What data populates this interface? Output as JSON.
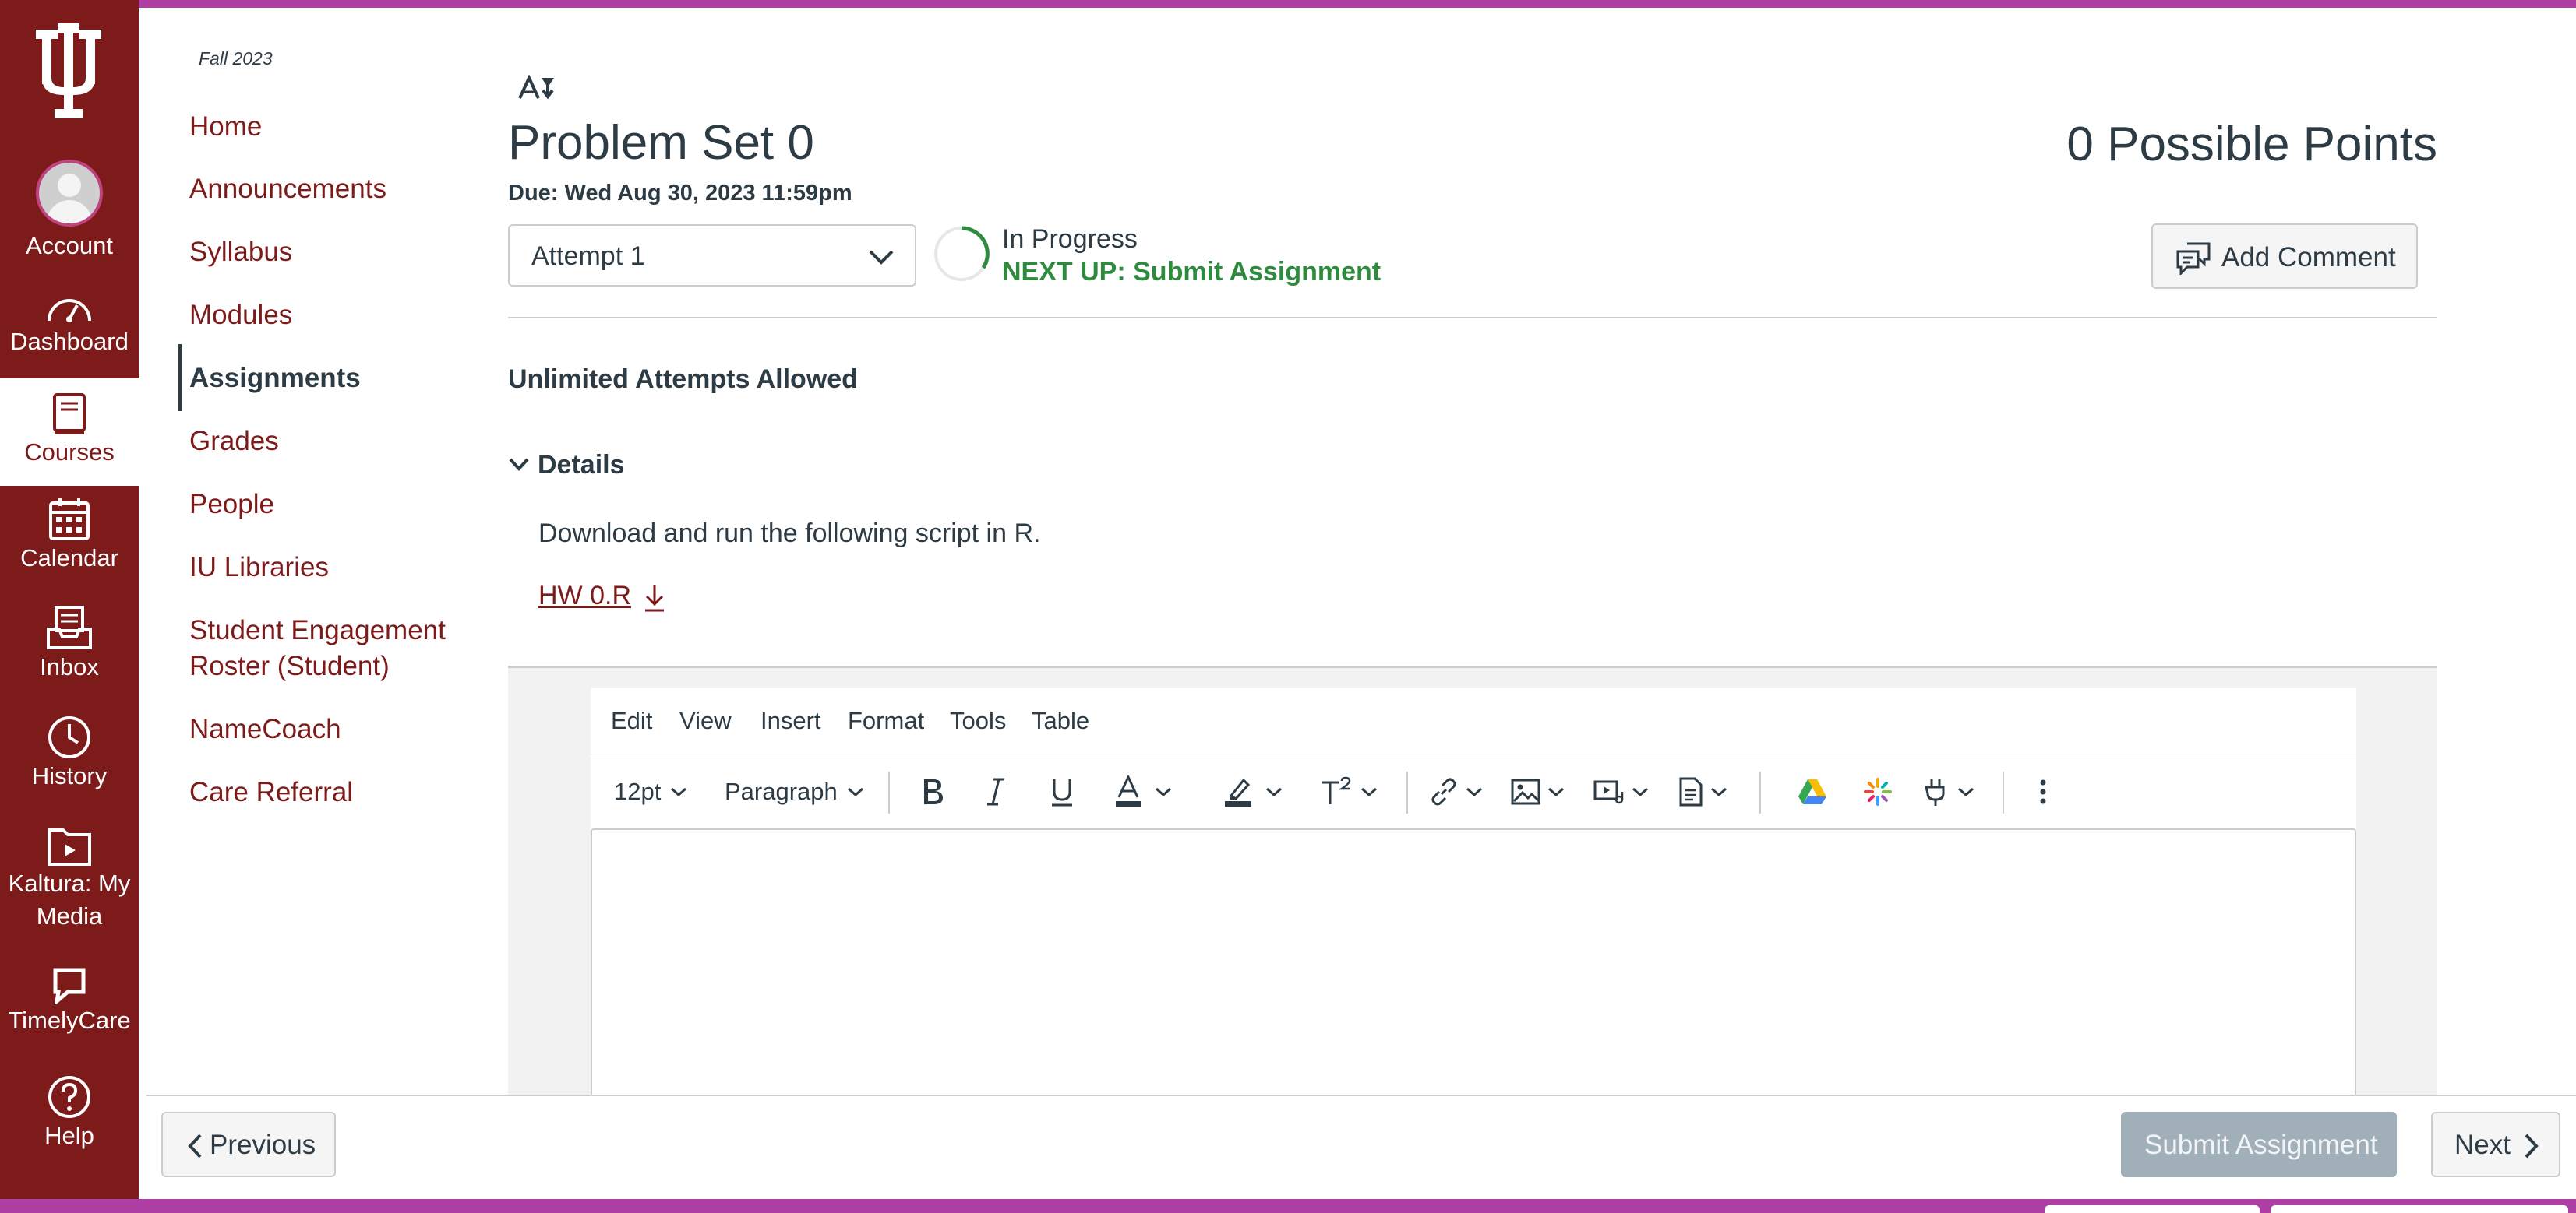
{
  "global_nav": {
    "items": [
      {
        "id": "account",
        "label": "Account"
      },
      {
        "id": "dashboard",
        "label": "Dashboard"
      },
      {
        "id": "courses",
        "label": "Courses"
      },
      {
        "id": "calendar",
        "label": "Calendar"
      },
      {
        "id": "inbox",
        "label": "Inbox"
      },
      {
        "id": "history",
        "label": "History"
      },
      {
        "id": "kaltura",
        "label": "Kaltura: My Media"
      },
      {
        "id": "timelycare",
        "label": "TimelyCare"
      },
      {
        "id": "help",
        "label": "Help"
      }
    ],
    "active": "courses"
  },
  "course_nav": {
    "term": "Fall 2023",
    "items": [
      {
        "label": "Home"
      },
      {
        "label": "Announcements"
      },
      {
        "label": "Syllabus"
      },
      {
        "label": "Modules"
      },
      {
        "label": "Assignments"
      },
      {
        "label": "Grades"
      },
      {
        "label": "People"
      },
      {
        "label": "IU Libraries"
      },
      {
        "label_line1": "Student Engagement",
        "label_line2": "Roster (Student)"
      },
      {
        "label": "NameCoach"
      },
      {
        "label": "Care Referral"
      }
    ],
    "active": "Assignments"
  },
  "assignment": {
    "title": "Problem Set 0",
    "points": "0 Possible Points",
    "due": "Due: Wed Aug 30, 2023 11:59pm",
    "attempt_selected": "Attempt 1",
    "status": "In Progress",
    "next_up": "NEXT UP: Submit Assignment",
    "add_comment": "Add Comment",
    "attempts_allowed": "Unlimited Attempts Allowed",
    "details_label": "Details",
    "description": "Download and run the following script in R.",
    "file_name": "HW 0.R"
  },
  "editor": {
    "menu": [
      "Edit",
      "View",
      "Insert",
      "Format",
      "Tools",
      "Table"
    ],
    "font_size": "12pt",
    "block_format": "Paragraph"
  },
  "footer": {
    "previous": "Previous",
    "submit": "Submit Assignment",
    "next": "Next"
  },
  "colors": {
    "nav_bg": "#7d1a1a",
    "accent_strip": "#b03fa5",
    "status_green": "#2e8b3e",
    "submit_disabled": "#a1afb9"
  }
}
